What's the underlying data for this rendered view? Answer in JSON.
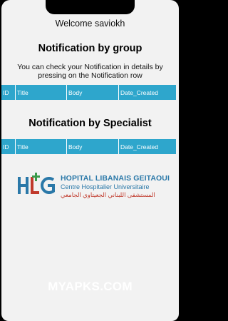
{
  "header": {
    "welcome_text": "Welcome saviokh"
  },
  "group_section": {
    "title": "Notification by group",
    "description": "You can check your Notification in details by pressing on the Notification row",
    "columns": [
      "ID",
      "Title",
      "Body",
      "Date_Created"
    ]
  },
  "specialist_section": {
    "title": "Notification by Specialist",
    "columns": [
      "ID",
      "Title",
      "Body",
      "Date_Created"
    ]
  },
  "logo": {
    "name_line1": "HOPITAL LIBANAIS GEITAOUI",
    "name_line2": "Centre Hospitalier Universitaire",
    "name_line3": "المستشفى اللبناني الجعيتاوي الجامعي"
  },
  "watermark": "MYAPKS.COM",
  "colors": {
    "table_header": "#2ea6cc",
    "background": "#f2f2f2",
    "logo_blue": "#2a78a8",
    "logo_red": "#c0392b"
  }
}
